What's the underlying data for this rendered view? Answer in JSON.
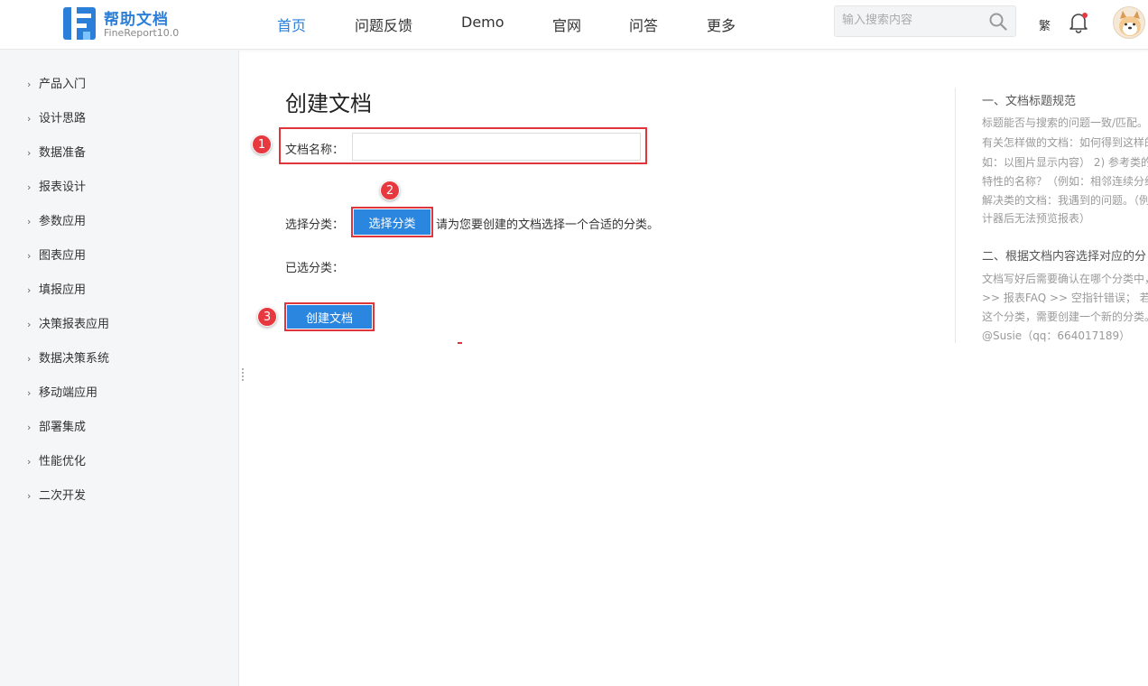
{
  "header": {
    "logo_title": "帮助文档",
    "logo_subtitle": "FineReport10.0",
    "nav": [
      "首页",
      "问题反馈",
      "Demo",
      "官网",
      "问答",
      "更多"
    ],
    "search_placeholder": "输入搜索内容",
    "lang_toggle": "繁",
    "accent_color": "#2b7fd8"
  },
  "sidebar": {
    "items": [
      {
        "label": "产品入门"
      },
      {
        "label": "设计思路"
      },
      {
        "label": "数据准备"
      },
      {
        "label": "报表设计"
      },
      {
        "label": "参数应用"
      },
      {
        "label": "图表应用"
      },
      {
        "label": "填报应用"
      },
      {
        "label": "决策报表应用"
      },
      {
        "label": "数据决策系统"
      },
      {
        "label": "移动端应用"
      },
      {
        "label": "部署集成"
      },
      {
        "label": "性能优化"
      },
      {
        "label": "二次开发"
      }
    ],
    "chevron": "›"
  },
  "main": {
    "title": "创建文档",
    "name_label": "文档名称：",
    "name_value": "",
    "category_label": "选择分类：",
    "select_button": "选择分类",
    "category_hint": "请为您要创建的文档选择一个合适的分类。",
    "selected_label": "已选分类：",
    "create_button": "创建文档",
    "markers": [
      "1",
      "2",
      "3"
    ],
    "annotation_color": "#e0353b"
  },
  "right_panel": {
    "section1_title": "一、文档标题规范",
    "section1_lines": [
      "标题能否与搜索的问题一致/匹配。",
      "有关怎样做的文档：如何得到这样的",
      "如：以图片显示内容） 2) 参考类的",
      "特性的名称？（例如：相邻连续分组",
      "解决类的文档：我遇到的问题。（例",
      "计器后无法预览报表）"
    ],
    "section2_title": "二、根据文档内容选择对应的分",
    "section2_lines": [
      "文档写好后需要确认在哪个分类中，",
      ">> 报表FAQ >> 空指针错误； 若",
      "这个分类，需要创建一个新的分类。",
      "@Susie（qq：664017189）"
    ]
  }
}
